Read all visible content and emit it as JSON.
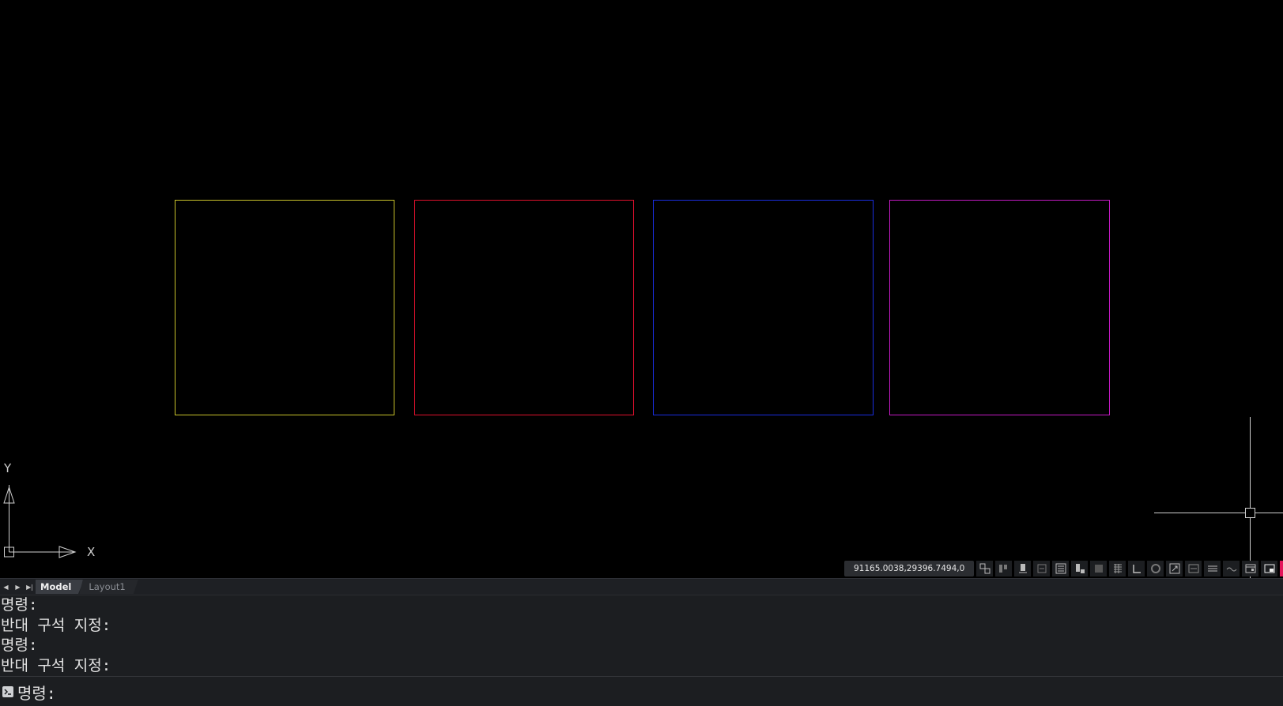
{
  "drawing": {
    "rectangles": [
      {
        "name": "yellow-rectangle",
        "color": "#c8c12a"
      },
      {
        "name": "red-rectangle",
        "color": "#e0102d"
      },
      {
        "name": "blue-rectangle",
        "color": "#1a2ee0"
      },
      {
        "name": "magenta-rectangle",
        "color": "#c41ac4"
      }
    ]
  },
  "ucs": {
    "x_label": "X",
    "y_label": "Y"
  },
  "status_bar": {
    "coordinates": "91165.0038,29396.7494,0",
    "buttons": [
      "model-space-icon",
      "grid-display-icon",
      "snap-icon",
      "infer-constraints-icon",
      "dynamic-input-icon",
      "ortho-icon",
      "polar-tracking-icon",
      "isometric-icon",
      "object-snap-tracking-icon",
      "object-snap-icon",
      "lineweight-icon",
      "transparency-icon",
      "selection-cycling-icon",
      "3d-osnap-icon",
      "dynamic-ucs-icon",
      "selection-filter-icon",
      "gizmo-icon",
      "annotation-visibility-icon",
      "auto-scale-icon",
      "workspace-icon",
      "customization-icon"
    ],
    "accent": "#e4145a"
  },
  "tabs": {
    "items": [
      {
        "label": "Model",
        "active": true
      },
      {
        "label": "Layout1",
        "active": false
      }
    ]
  },
  "command": {
    "history": [
      "명령:",
      "반대 구석 지정:",
      "명령:",
      "반대 구석 지정:"
    ],
    "prompt": "명령:",
    "input_value": "",
    "input_placeholder": ""
  }
}
